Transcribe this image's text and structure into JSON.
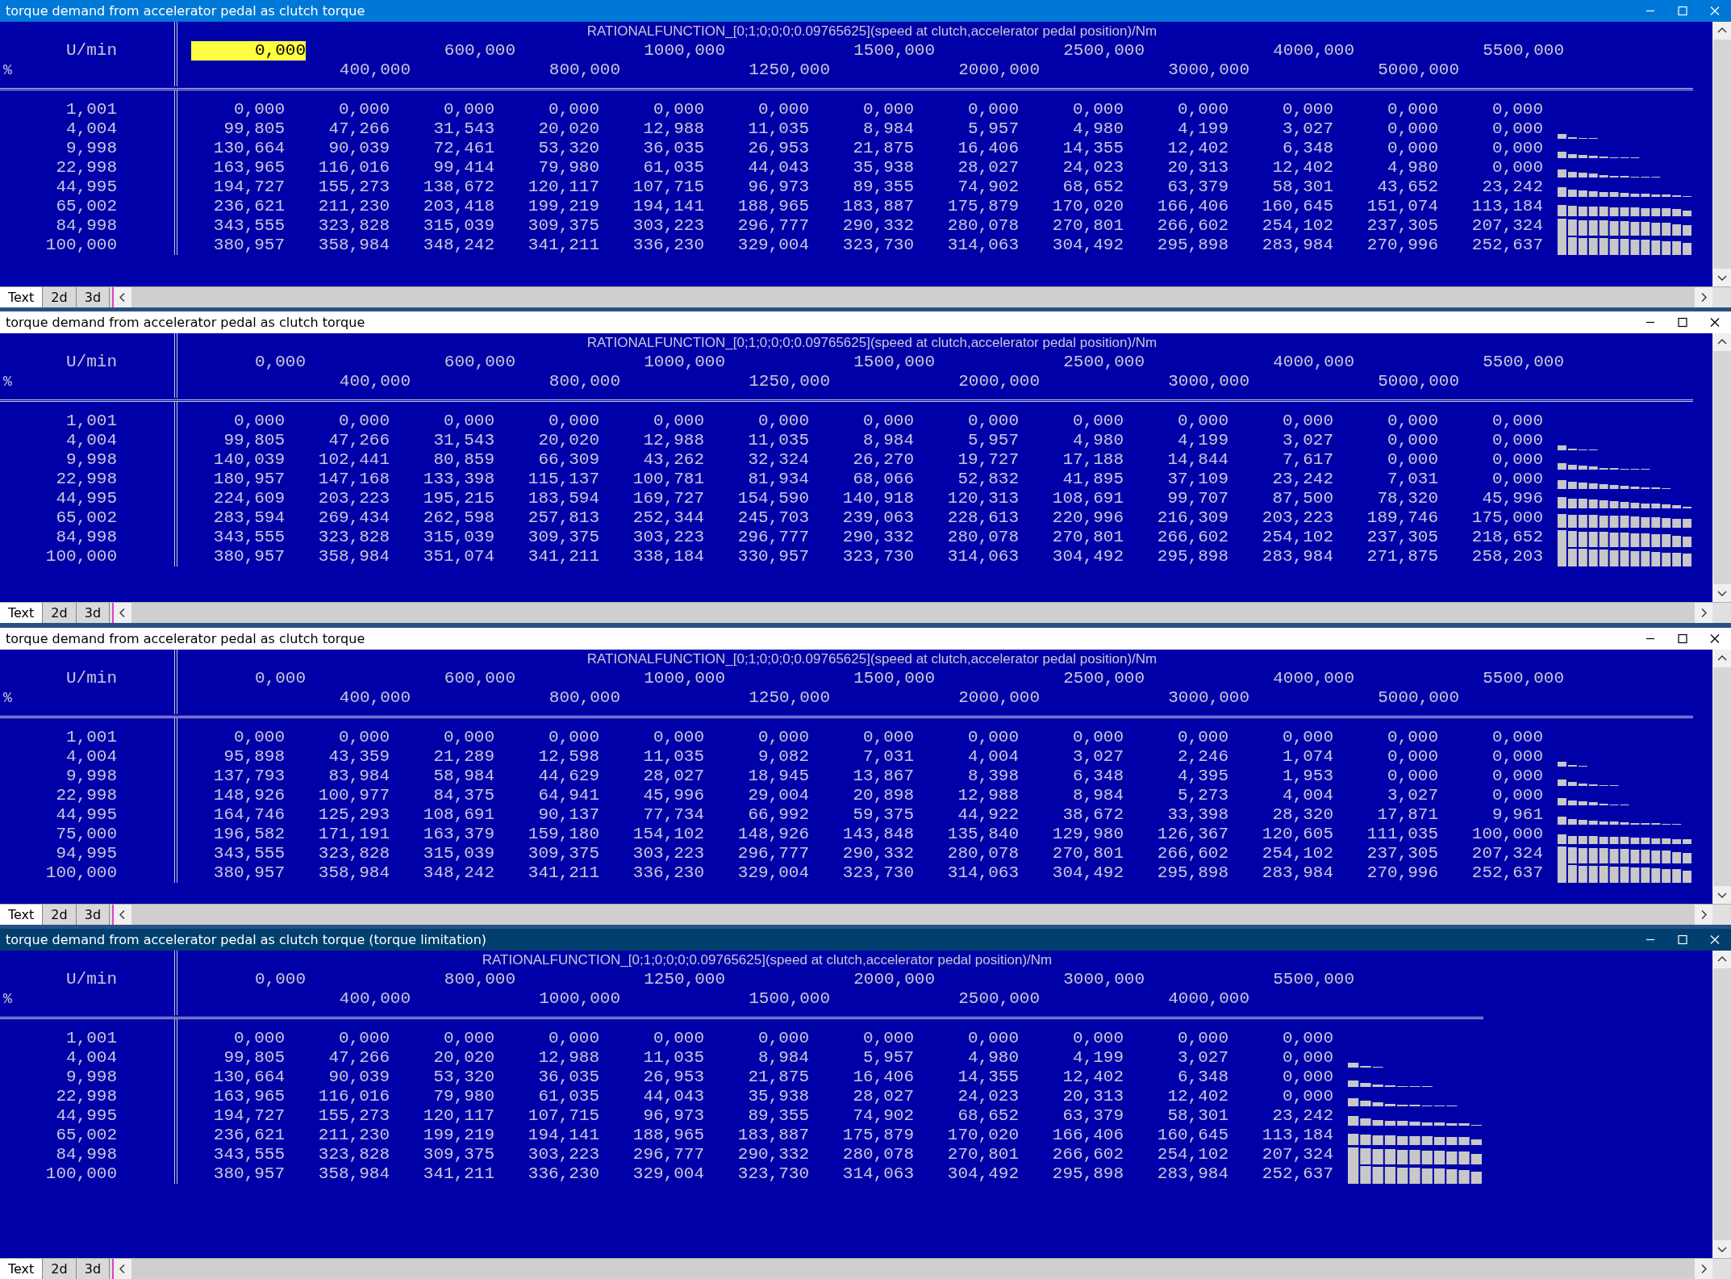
{
  "windows": [
    {
      "title": "torque demand from accelerator pedal as clutch torque",
      "kind": "active",
      "function_label": "RATIONALFUNCTION_[0;1;0;0;0;0.09765625](speed at clutch,accelerator pedal position)/Nm",
      "x_unit": "U/min",
      "y_unit": "%",
      "x_axis": [
        {
          "value": "0,000",
          "selected": true
        },
        {
          "value": "400,000",
          "selected": false
        },
        {
          "value": "600,000",
          "selected": false
        },
        {
          "value": "800,000",
          "selected": false
        },
        {
          "value": "1000,000",
          "selected": false
        },
        {
          "value": "1250,000",
          "selected": false
        },
        {
          "value": "1500,000",
          "selected": false
        },
        {
          "value": "2000,000",
          "selected": false
        },
        {
          "value": "2500,000",
          "selected": false
        },
        {
          "value": "3000,000",
          "selected": false
        },
        {
          "value": "4000,000",
          "selected": false
        },
        {
          "value": "5000,000",
          "selected": false
        },
        {
          "value": "5500,000",
          "selected": false
        }
      ],
      "rows": [
        {
          "label": "1,001",
          "cells": [
            "0,000",
            "0,000",
            "0,000",
            "0,000",
            "0,000",
            "0,000",
            "0,000",
            "0,000",
            "0,000",
            "0,000",
            "0,000",
            "0,000",
            "0,000"
          ]
        },
        {
          "label": "4,004",
          "cells": [
            "99,805",
            "47,266",
            "31,543",
            "20,020",
            "12,988",
            "11,035",
            "8,984",
            "5,957",
            "4,980",
            "4,199",
            "3,027",
            "0,000",
            "0,000"
          ]
        },
        {
          "label": "9,998",
          "cells": [
            "130,664",
            "90,039",
            "72,461",
            "53,320",
            "36,035",
            "26,953",
            "21,875",
            "16,406",
            "14,355",
            "12,402",
            "6,348",
            "0,000",
            "0,000"
          ]
        },
        {
          "label": "22,998",
          "cells": [
            "163,965",
            "116,016",
            "99,414",
            "79,980",
            "61,035",
            "44,043",
            "35,938",
            "28,027",
            "24,023",
            "20,313",
            "12,402",
            "4,980",
            "0,000"
          ]
        },
        {
          "label": "44,995",
          "cells": [
            "194,727",
            "155,273",
            "138,672",
            "120,117",
            "107,715",
            "96,973",
            "89,355",
            "74,902",
            "68,652",
            "63,379",
            "58,301",
            "43,652",
            "23,242"
          ]
        },
        {
          "label": "65,002",
          "cells": [
            "236,621",
            "211,230",
            "203,418",
            "199,219",
            "194,141",
            "188,965",
            "183,887",
            "175,879",
            "170,020",
            "166,406",
            "160,645",
            "151,074",
            "113,184"
          ]
        },
        {
          "label": "84,998",
          "cells": [
            "343,555",
            "323,828",
            "315,039",
            "309,375",
            "303,223",
            "296,777",
            "290,332",
            "280,078",
            "270,801",
            "266,602",
            "254,102",
            "237,305",
            "207,324"
          ]
        },
        {
          "label": "100,000",
          "cells": [
            "380,957",
            "358,984",
            "348,242",
            "341,211",
            "336,230",
            "329,004",
            "323,730",
            "314,063",
            "304,492",
            "295,898",
            "283,984",
            "270,996",
            "252,637"
          ]
        }
      ],
      "tabs": [
        {
          "label": "Text",
          "selected": true
        },
        {
          "label": "2d",
          "selected": false
        },
        {
          "label": "3d",
          "selected": false
        }
      ]
    },
    {
      "title": "torque demand from accelerator pedal as clutch torque",
      "kind": "inactive",
      "function_label": "RATIONALFUNCTION_[0;1;0;0;0;0.09765625](speed at clutch,accelerator pedal position)/Nm",
      "x_unit": "U/min",
      "y_unit": "%",
      "x_axis": [
        {
          "value": "0,000",
          "selected": false
        },
        {
          "value": "400,000",
          "selected": false
        },
        {
          "value": "600,000",
          "selected": false
        },
        {
          "value": "800,000",
          "selected": false
        },
        {
          "value": "1000,000",
          "selected": false
        },
        {
          "value": "1250,000",
          "selected": false
        },
        {
          "value": "1500,000",
          "selected": false
        },
        {
          "value": "2000,000",
          "selected": false
        },
        {
          "value": "2500,000",
          "selected": false
        },
        {
          "value": "3000,000",
          "selected": false
        },
        {
          "value": "4000,000",
          "selected": false
        },
        {
          "value": "5000,000",
          "selected": false
        },
        {
          "value": "5500,000",
          "selected": false
        }
      ],
      "rows": [
        {
          "label": "1,001",
          "cells": [
            "0,000",
            "0,000",
            "0,000",
            "0,000",
            "0,000",
            "0,000",
            "0,000",
            "0,000",
            "0,000",
            "0,000",
            "0,000",
            "0,000",
            "0,000"
          ]
        },
        {
          "label": "4,004",
          "cells": [
            "99,805",
            "47,266",
            "31,543",
            "20,020",
            "12,988",
            "11,035",
            "8,984",
            "5,957",
            "4,980",
            "4,199",
            "3,027",
            "0,000",
            "0,000"
          ]
        },
        {
          "label": "9,998",
          "cells": [
            "140,039",
            "102,441",
            "80,859",
            "66,309",
            "43,262",
            "32,324",
            "26,270",
            "19,727",
            "17,188",
            "14,844",
            "7,617",
            "0,000",
            "0,000"
          ]
        },
        {
          "label": "22,998",
          "cells": [
            "180,957",
            "147,168",
            "133,398",
            "115,137",
            "100,781",
            "81,934",
            "68,066",
            "52,832",
            "41,895",
            "37,109",
            "23,242",
            "7,031",
            "0,000"
          ]
        },
        {
          "label": "44,995",
          "cells": [
            "224,609",
            "203,223",
            "195,215",
            "183,594",
            "169,727",
            "154,590",
            "140,918",
            "120,313",
            "108,691",
            "99,707",
            "87,500",
            "78,320",
            "45,996"
          ]
        },
        {
          "label": "65,002",
          "cells": [
            "283,594",
            "269,434",
            "262,598",
            "257,813",
            "252,344",
            "245,703",
            "239,063",
            "228,613",
            "220,996",
            "216,309",
            "203,223",
            "189,746",
            "175,000"
          ]
        },
        {
          "label": "84,998",
          "cells": [
            "343,555",
            "323,828",
            "315,039",
            "309,375",
            "303,223",
            "296,777",
            "290,332",
            "280,078",
            "270,801",
            "266,602",
            "254,102",
            "237,305",
            "218,652"
          ]
        },
        {
          "label": "100,000",
          "cells": [
            "380,957",
            "358,984",
            "351,074",
            "341,211",
            "338,184",
            "330,957",
            "323,730",
            "314,063",
            "304,492",
            "295,898",
            "283,984",
            "271,875",
            "258,203"
          ]
        }
      ],
      "tabs": [
        {
          "label": "Text",
          "selected": true
        },
        {
          "label": "2d",
          "selected": false
        },
        {
          "label": "3d",
          "selected": false
        }
      ]
    },
    {
      "title": "torque demand from accelerator pedal as clutch torque",
      "kind": "inactive",
      "function_label": "RATIONALFUNCTION_[0;1;0;0;0;0.09765625](speed at clutch,accelerator pedal position)/Nm",
      "x_unit": "U/min",
      "y_unit": "%",
      "x_axis": [
        {
          "value": "0,000",
          "selected": false
        },
        {
          "value": "400,000",
          "selected": false
        },
        {
          "value": "600,000",
          "selected": false
        },
        {
          "value": "800,000",
          "selected": false
        },
        {
          "value": "1000,000",
          "selected": false
        },
        {
          "value": "1250,000",
          "selected": false
        },
        {
          "value": "1500,000",
          "selected": false
        },
        {
          "value": "2000,000",
          "selected": false
        },
        {
          "value": "2500,000",
          "selected": false
        },
        {
          "value": "3000,000",
          "selected": false
        },
        {
          "value": "4000,000",
          "selected": false
        },
        {
          "value": "5000,000",
          "selected": false
        },
        {
          "value": "5500,000",
          "selected": false
        }
      ],
      "rows": [
        {
          "label": "1,001",
          "cells": [
            "0,000",
            "0,000",
            "0,000",
            "0,000",
            "0,000",
            "0,000",
            "0,000",
            "0,000",
            "0,000",
            "0,000",
            "0,000",
            "0,000",
            "0,000"
          ]
        },
        {
          "label": "4,004",
          "cells": [
            "95,898",
            "43,359",
            "21,289",
            "12,598",
            "11,035",
            "9,082",
            "7,031",
            "4,004",
            "3,027",
            "2,246",
            "1,074",
            "0,000",
            "0,000"
          ]
        },
        {
          "label": "9,998",
          "cells": [
            "137,793",
            "83,984",
            "58,984",
            "44,629",
            "28,027",
            "18,945",
            "13,867",
            "8,398",
            "6,348",
            "4,395",
            "1,953",
            "0,000",
            "0,000"
          ]
        },
        {
          "label": "22,998",
          "cells": [
            "148,926",
            "100,977",
            "84,375",
            "64,941",
            "45,996",
            "29,004",
            "20,898",
            "12,988",
            "8,984",
            "5,273",
            "4,004",
            "3,027",
            "0,000"
          ]
        },
        {
          "label": "44,995",
          "cells": [
            "164,746",
            "125,293",
            "108,691",
            "90,137",
            "77,734",
            "66,992",
            "59,375",
            "44,922",
            "38,672",
            "33,398",
            "28,320",
            "17,871",
            "9,961"
          ]
        },
        {
          "label": "75,000",
          "cells": [
            "196,582",
            "171,191",
            "163,379",
            "159,180",
            "154,102",
            "148,926",
            "143,848",
            "135,840",
            "129,980",
            "126,367",
            "120,605",
            "111,035",
            "100,000"
          ]
        },
        {
          "label": "94,995",
          "cells": [
            "343,555",
            "323,828",
            "315,039",
            "309,375",
            "303,223",
            "296,777",
            "290,332",
            "280,078",
            "270,801",
            "266,602",
            "254,102",
            "237,305",
            "207,324"
          ]
        },
        {
          "label": "100,000",
          "cells": [
            "380,957",
            "358,984",
            "348,242",
            "341,211",
            "336,230",
            "329,004",
            "323,730",
            "314,063",
            "304,492",
            "295,898",
            "283,984",
            "270,996",
            "252,637"
          ]
        }
      ],
      "tabs": [
        {
          "label": "Text",
          "selected": true
        },
        {
          "label": "2d",
          "selected": false
        },
        {
          "label": "3d",
          "selected": false
        }
      ]
    },
    {
      "title": "torque demand from accelerator pedal as clutch torque (torque limitation)",
      "kind": "inactive-dark",
      "function_label": "RATIONALFUNCTION_[0;1;0;0;0;0.09765625](speed at clutch,accelerator pedal position)/Nm",
      "x_unit": "U/min",
      "y_unit": "%",
      "x_axis": [
        {
          "value": "0,000",
          "selected": false
        },
        {
          "value": "400,000",
          "selected": false
        },
        {
          "value": "800,000",
          "selected": false
        },
        {
          "value": "1000,000",
          "selected": false
        },
        {
          "value": "1250,000",
          "selected": false
        },
        {
          "value": "1500,000",
          "selected": false
        },
        {
          "value": "2000,000",
          "selected": false
        },
        {
          "value": "2500,000",
          "selected": false
        },
        {
          "value": "3000,000",
          "selected": false
        },
        {
          "value": "4000,000",
          "selected": false
        },
        {
          "value": "5500,000",
          "selected": false
        }
      ],
      "rows": [
        {
          "label": "1,001",
          "cells": [
            "0,000",
            "0,000",
            "0,000",
            "0,000",
            "0,000",
            "0,000",
            "0,000",
            "0,000",
            "0,000",
            "0,000",
            "0,000"
          ]
        },
        {
          "label": "4,004",
          "cells": [
            "99,805",
            "47,266",
            "20,020",
            "12,988",
            "11,035",
            "8,984",
            "5,957",
            "4,980",
            "4,199",
            "3,027",
            "0,000"
          ]
        },
        {
          "label": "9,998",
          "cells": [
            "130,664",
            "90,039",
            "53,320",
            "36,035",
            "26,953",
            "21,875",
            "16,406",
            "14,355",
            "12,402",
            "6,348",
            "0,000"
          ]
        },
        {
          "label": "22,998",
          "cells": [
            "163,965",
            "116,016",
            "79,980",
            "61,035",
            "44,043",
            "35,938",
            "28,027",
            "24,023",
            "20,313",
            "12,402",
            "0,000"
          ]
        },
        {
          "label": "44,995",
          "cells": [
            "194,727",
            "155,273",
            "120,117",
            "107,715",
            "96,973",
            "89,355",
            "74,902",
            "68,652",
            "63,379",
            "58,301",
            "23,242"
          ]
        },
        {
          "label": "65,002",
          "cells": [
            "236,621",
            "211,230",
            "199,219",
            "194,141",
            "188,965",
            "183,887",
            "175,879",
            "170,020",
            "166,406",
            "160,645",
            "113,184"
          ]
        },
        {
          "label": "84,998",
          "cells": [
            "343,555",
            "323,828",
            "309,375",
            "303,223",
            "296,777",
            "290,332",
            "280,078",
            "270,801",
            "266,602",
            "254,102",
            "207,324"
          ]
        },
        {
          "label": "100,000",
          "cells": [
            "380,957",
            "358,984",
            "341,211",
            "336,230",
            "329,004",
            "323,730",
            "314,063",
            "304,492",
            "295,898",
            "283,984",
            "252,637"
          ]
        }
      ],
      "tabs": [
        {
          "label": "Text",
          "selected": true
        },
        {
          "label": "2d",
          "selected": false
        },
        {
          "label": "3d",
          "selected": false
        }
      ]
    }
  ]
}
